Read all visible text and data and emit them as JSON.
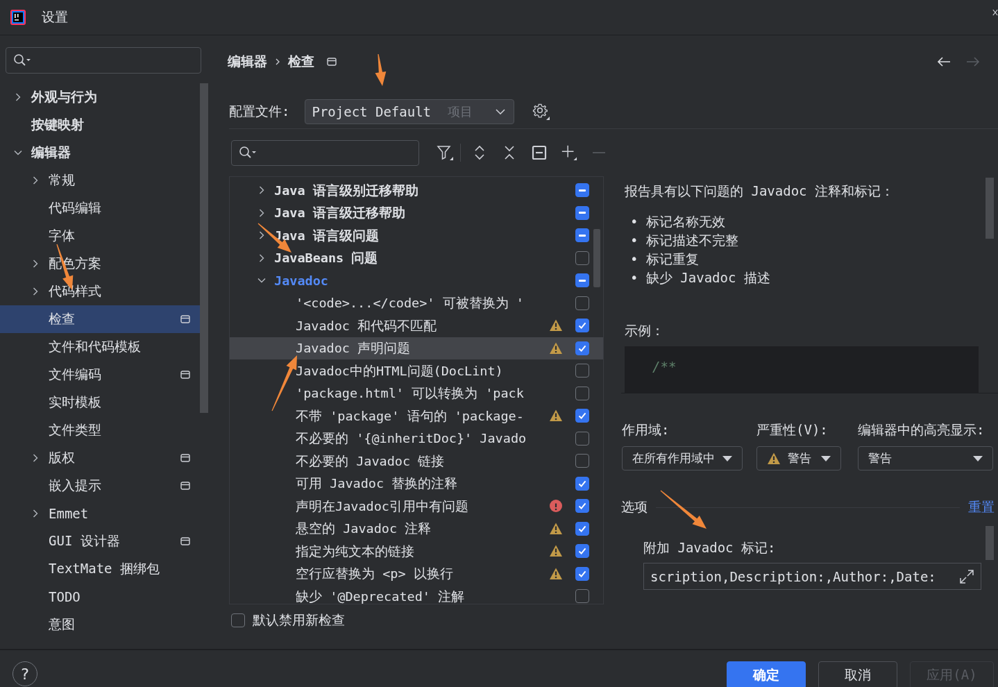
{
  "window": {
    "title": "设置"
  },
  "sidebar": {
    "items": [
      {
        "label": "外观与行为",
        "expanded": false,
        "selected": false,
        "project_scope": false
      },
      {
        "label": "按键映射",
        "selected": false,
        "project_scope": false
      },
      {
        "label": "编辑器",
        "expanded": true,
        "selected": false,
        "project_scope": false,
        "children": [
          {
            "label": "常规",
            "expanded": false,
            "selected": false,
            "project_scope": false
          },
          {
            "label": "代码编辑",
            "selected": false,
            "project_scope": false
          },
          {
            "label": "字体",
            "selected": false,
            "project_scope": false
          },
          {
            "label": "配色方案",
            "expanded": false,
            "selected": false,
            "project_scope": false
          },
          {
            "label": "代码样式",
            "expanded": false,
            "selected": false,
            "project_scope": false
          },
          {
            "label": "检查",
            "selected": true,
            "project_scope": true
          },
          {
            "label": "文件和代码模板",
            "selected": false,
            "project_scope": false
          },
          {
            "label": "文件编码",
            "selected": false,
            "project_scope": true
          },
          {
            "label": "实时模板",
            "selected": false,
            "project_scope": false
          },
          {
            "label": "文件类型",
            "selected": false,
            "project_scope": false
          },
          {
            "label": "版权",
            "expanded": false,
            "selected": false,
            "project_scope": true
          },
          {
            "label": "嵌入提示",
            "selected": false,
            "project_scope": true
          },
          {
            "label": "Emmet",
            "expanded": false,
            "selected": false,
            "project_scope": false
          },
          {
            "label": "GUI 设计器",
            "selected": false,
            "project_scope": true
          },
          {
            "label": "TextMate 捆绑包",
            "selected": false,
            "project_scope": false
          },
          {
            "label": "TODO",
            "selected": false,
            "project_scope": false
          },
          {
            "label": "意图",
            "selected": false,
            "project_scope": false
          }
        ]
      }
    ]
  },
  "breadcrumb": {
    "items": [
      "编辑器",
      "检查"
    ],
    "project_scope": true
  },
  "nav": [
    {
      "kind": "back",
      "disabled": false
    },
    {
      "kind": "forward",
      "disabled": true
    }
  ],
  "profile": {
    "label": "配置文件:",
    "value": "Project Default",
    "scope": "项目"
  },
  "inspections": [
    {
      "label": "Java 语言级别迁移帮助",
      "expanded": false,
      "partial": true,
      "selected": false,
      "modified": false
    },
    {
      "label": "Java 语言级迁移帮助",
      "expanded": false,
      "partial": true,
      "selected": false,
      "modified": false
    },
    {
      "label": "Java 语言级问题",
      "expanded": false,
      "partial": true,
      "selected": false,
      "modified": false
    },
    {
      "label": "JavaBeans 问题",
      "expanded": false,
      "checked": false,
      "selected": false,
      "modified": false
    },
    {
      "label": "Javadoc",
      "expanded": true,
      "partial": true,
      "selected": false,
      "modified": true,
      "children": [
        {
          "label": "'<code>...</code>' 可被替换为 '",
          "kind": "plain",
          "checked": false,
          "selected": false,
          "modified": false
        },
        {
          "label": "Javadoc 和代码不匹配",
          "kind": "warning",
          "checked": true,
          "selected": false,
          "modified": false
        },
        {
          "label": "Javadoc 声明问题",
          "kind": "warning",
          "checked": true,
          "selected": true,
          "modified": false
        },
        {
          "label": "Javadoc中的HTML问题(DocLint)",
          "kind": "plain",
          "checked": false,
          "selected": false,
          "modified": false
        },
        {
          "label": "'package.html' 可以转换为 'pack",
          "kind": "plain",
          "checked": false,
          "selected": false,
          "modified": false
        },
        {
          "label": "不带 'package' 语句的 'package-",
          "kind": "warning",
          "checked": true,
          "selected": false,
          "modified": false
        },
        {
          "label": "不必要的 '{@inheritDoc}' Javado",
          "kind": "plain",
          "checked": false,
          "selected": false,
          "modified": false
        },
        {
          "label": "不必要的 Javadoc 链接",
          "kind": "plain",
          "checked": false,
          "selected": false,
          "modified": false
        },
        {
          "label": "可用 Javadoc 替换的注释",
          "kind": "plain",
          "checked": true,
          "selected": false,
          "modified": false
        },
        {
          "label": "声明在Javadoc引用中有问题",
          "kind": "error",
          "checked": true,
          "selected": false,
          "modified": false
        },
        {
          "label": "悬空的 Javadoc 注释",
          "kind": "warning",
          "checked": true,
          "selected": false,
          "modified": false
        },
        {
          "label": "指定为纯文本的链接",
          "kind": "warning",
          "checked": true,
          "selected": false,
          "modified": false
        },
        {
          "label": "空行应替换为 <p> 以换行",
          "kind": "warning",
          "checked": true,
          "selected": false,
          "modified": false
        },
        {
          "label": "缺少 '@Deprecated' 注解",
          "kind": "plain",
          "checked": false,
          "selected": false,
          "modified": false
        }
      ]
    }
  ],
  "disable_new": {
    "label": "默认禁用新检查",
    "checked": false
  },
  "description": {
    "intro": "报告具有以下问题的 Javadoc 注释和标记：",
    "bullets": [
      "• 标记名称无效",
      "• 标记描述不完整",
      "• 标记重复",
      "• 缺少 Javadoc 描述"
    ],
    "example_label": "示例：",
    "example_code": "/**"
  },
  "settings": {
    "scope": {
      "label": "作用域:",
      "value": "在所有作用域中"
    },
    "severity": {
      "label": "严重性(V):",
      "value": "警告",
      "warning": true
    },
    "highlight": {
      "label": "编辑器中的高亮显示:",
      "value": "警告"
    }
  },
  "options": {
    "title": "选项",
    "reset": "重置",
    "tags_label": "附加 Javadoc 标记:",
    "tags_value": "scription,Description:,Author:,Date:"
  },
  "help": "?",
  "buttons": [
    {
      "label": "确定",
      "kind": "primary",
      "disabled": false
    },
    {
      "label": "取消",
      "kind": "normal",
      "disabled": false
    },
    {
      "label": "应用(A)",
      "kind": "normal",
      "disabled": true
    }
  ]
}
